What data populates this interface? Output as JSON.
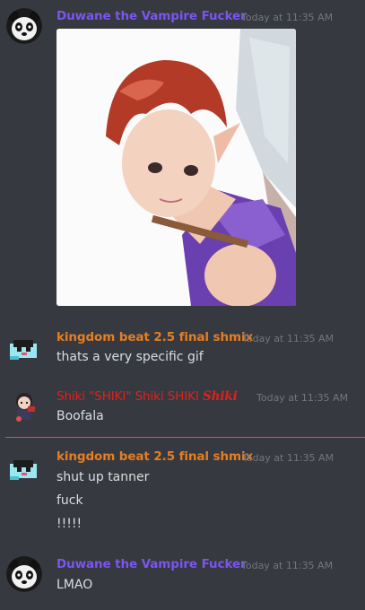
{
  "messages": [
    {
      "author": "Duwane the Vampire Fucker",
      "author_color": "#7b55f0",
      "timestamp": "Today at 11:35 AM",
      "avatar_icon": "panda-avatar",
      "attachment": "fairy-anime-gif"
    },
    {
      "author": "kingdom beat 2.5 final shmix",
      "author_color": "#e67e22",
      "timestamp": "Today at 11:35 AM",
      "avatar_icon": "pixel-character-avatar",
      "lines": [
        "thats a very specific gif"
      ]
    },
    {
      "author_parts": [
        "Shiki \"SHIKI\" Shiki SHIKI",
        "Shiki"
      ],
      "author_color": "#e02020",
      "timestamp": "Today at 11:35 AM",
      "avatar_icon": "chibi-character-avatar",
      "lines": [
        "Boofala"
      ]
    },
    {
      "author": "kingdom beat 2.5 final shmix",
      "author_color": "#e67e22",
      "timestamp": "Today at 11:35 AM",
      "avatar_icon": "pixel-character-avatar",
      "lines": [
        "shut up tanner",
        "fuck",
        "!!!!!"
      ]
    },
    {
      "author": "Duwane the Vampire Fucker",
      "author_color": "#7b55f0",
      "timestamp": "Today at 11:35 AM",
      "avatar_icon": "panda-avatar",
      "lines": [
        "LMAO"
      ]
    }
  ],
  "divider_color": "#f04747"
}
